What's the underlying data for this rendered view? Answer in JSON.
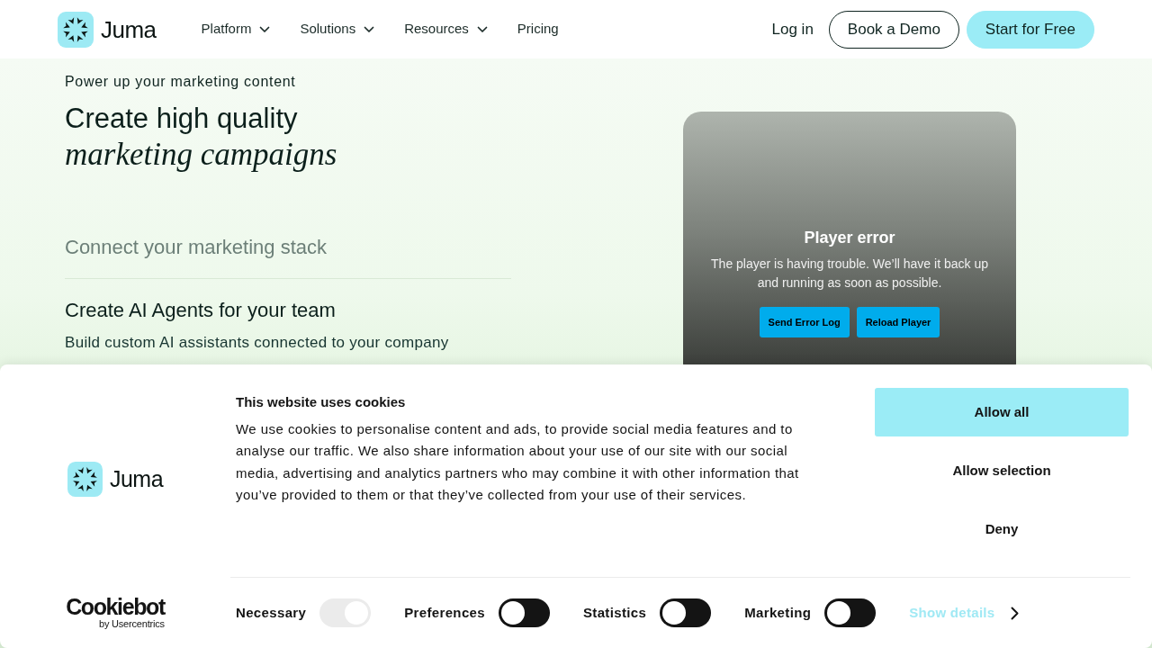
{
  "navbar": {
    "brand": "Juma",
    "menu": [
      {
        "label": "Platform",
        "kind": "dropdown"
      },
      {
        "label": "Solutions",
        "kind": "dropdown"
      },
      {
        "label": "Resources",
        "kind": "dropdown"
      },
      {
        "label": "Pricing",
        "kind": "link"
      }
    ],
    "login": "Log in",
    "demo_button": "Book a Demo",
    "start_button": "Start for Free"
  },
  "hero": {
    "eyebrow": "Power up your marketing content",
    "title": "Create high quality",
    "title_italic": "marketing campaigns",
    "features": [
      {
        "title": "Connect your marketing stack",
        "expanded": false
      },
      {
        "title": "Create AI Agents for your team",
        "expanded": true,
        "description": "Build custom AI assistants connected to your company"
      }
    ]
  },
  "player": {
    "title": "Player error",
    "message": "The player is having trouble. We’ll have it back up and running as soon as possible.",
    "buttons": [
      "Send Error Log",
      "Reload Player"
    ]
  },
  "cookie_banner": {
    "brand": "Juma",
    "provider": "Cookiebot",
    "provider_tagline": "by Usercentrics",
    "title": "This website uses cookies",
    "text": "We use cookies to personalise content and ads, to provide social media features and to analyse our traffic. We also share information about your use of our site with our social media, advertising and analytics partners who may combine it with other information that you’ve provided to them or that they’ve collected from your use of their services.",
    "actions": [
      {
        "label": "Allow all",
        "kind": "primary"
      },
      {
        "label": "Allow selection",
        "kind": "plain"
      },
      {
        "label": "Deny",
        "kind": "plain"
      }
    ],
    "toggles": [
      {
        "label": "Necessary",
        "checked": true,
        "disabled": true
      },
      {
        "label": "Preferences",
        "checked": false,
        "disabled": false
      },
      {
        "label": "Statistics",
        "checked": false,
        "disabled": false
      },
      {
        "label": "Marketing",
        "checked": false,
        "disabled": false
      }
    ],
    "details_link": "Show details"
  }
}
